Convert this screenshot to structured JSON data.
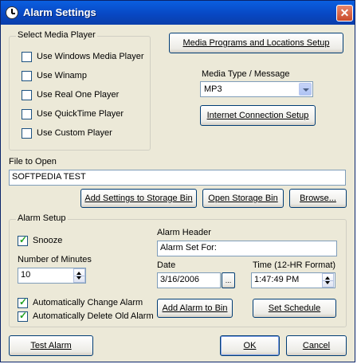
{
  "window": {
    "title": "Alarm Settings",
    "close_glyph": "✕"
  },
  "media_player": {
    "group_label": "Select Media Player",
    "options": [
      {
        "label": "Use Windows Media Player",
        "checked": false
      },
      {
        "label": "Use Winamp",
        "checked": false
      },
      {
        "label": "Use Real One Player",
        "checked": false
      },
      {
        "label": "Use QuickTime Player",
        "checked": false
      },
      {
        "label": "Use Custom Player",
        "checked": false
      }
    ]
  },
  "media_programs_button": "Media Programs and Locations Setup",
  "media_type": {
    "label": "Media Type / Message",
    "value": "MP3"
  },
  "internet_setup_button": "Internet Connection Setup",
  "file_to_open": {
    "label": "File to Open",
    "value": "SOFTPEDIA TEST"
  },
  "storage": {
    "add_button": "Add Settings to Storage Bin",
    "open_button": "Open Storage Bin",
    "browse_button": "Browse..."
  },
  "alarm_setup": {
    "group_label": "Alarm Setup",
    "snooze": {
      "label": "Snooze",
      "checked": true
    },
    "minutes": {
      "label": "Number of Minutes",
      "value": "10"
    },
    "auto_change": {
      "label": "Automatically Change Alarm",
      "checked": true
    },
    "auto_delete": {
      "label": "Automatically Delete Old Alarm",
      "checked": true
    },
    "header": {
      "label": "Alarm Header",
      "value": "Alarm Set For:"
    },
    "date": {
      "label": "Date",
      "value": "3/16/2006",
      "picker_glyph": "..."
    },
    "time": {
      "label": "Time (12-HR Format)",
      "value": "1:47:49 PM"
    },
    "add_alarm_button": "Add Alarm to Bin",
    "set_schedule_button": "Set Schedule"
  },
  "footer": {
    "test_button": "Test Alarm",
    "ok_button": "OK",
    "cancel_button": "Cancel"
  }
}
